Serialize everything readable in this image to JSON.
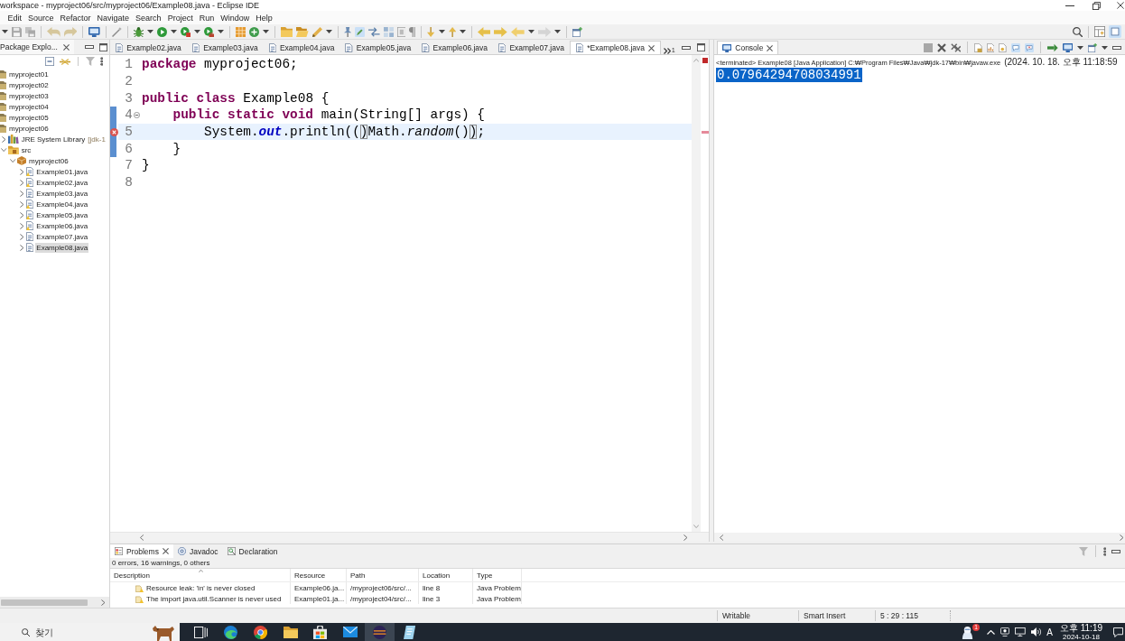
{
  "window": {
    "title": "workspace - myproject06/src/myproject06/Example08.java - Eclipse IDE"
  },
  "menu": [
    "Edit",
    "Source",
    "Refactor",
    "Navigate",
    "Search",
    "Project",
    "Run",
    "Window",
    "Help"
  ],
  "package_explorer": {
    "title": "Package Explo...",
    "tree": [
      {
        "label": "myproject01",
        "kind": "project",
        "selected": false
      },
      {
        "label": "myproject02",
        "kind": "project",
        "selected": false
      },
      {
        "label": "myproject03",
        "kind": "project",
        "selected": false
      },
      {
        "label": "myproject04",
        "kind": "project",
        "selected": false
      },
      {
        "label": "myproject05",
        "kind": "project",
        "selected": false
      },
      {
        "label": "myproject06",
        "kind": "project",
        "selected": false,
        "children": [
          {
            "label": "JRE System Library",
            "decoration": "[jdk-1",
            "kind": "library",
            "expanded": false,
            "selected": false
          },
          {
            "label": "src",
            "kind": "source-folder",
            "expanded": true,
            "selected": false,
            "children": [
              {
                "label": "myproject06",
                "kind": "package",
                "expanded": true,
                "selected": false,
                "children": [
                  {
                    "label": "Example01.java",
                    "kind": "java-file",
                    "warning": true,
                    "expanded": false,
                    "selected": false
                  },
                  {
                    "label": "Example02.java",
                    "kind": "java-file",
                    "warning": true,
                    "expanded": false,
                    "selected": false
                  },
                  {
                    "label": "Example03.java",
                    "kind": "java-file",
                    "warning": false,
                    "expanded": false,
                    "selected": false
                  },
                  {
                    "label": "Example04.java",
                    "kind": "java-file",
                    "warning": true,
                    "expanded": false,
                    "selected": false
                  },
                  {
                    "label": "Example05.java",
                    "kind": "java-file",
                    "warning": true,
                    "expanded": false,
                    "selected": false
                  },
                  {
                    "label": "Example06.java",
                    "kind": "java-file",
                    "warning": true,
                    "expanded": false,
                    "selected": false
                  },
                  {
                    "label": "Example07.java",
                    "kind": "java-file",
                    "warning": false,
                    "expanded": false,
                    "selected": false
                  },
                  {
                    "label": "Example08.java",
                    "kind": "java-file",
                    "warning": false,
                    "expanded": false,
                    "selected": true
                  }
                ]
              }
            ]
          }
        ]
      }
    ]
  },
  "editor": {
    "tabs": [
      {
        "label": "Example02.java",
        "selected": false
      },
      {
        "label": "Example03.java",
        "selected": false
      },
      {
        "label": "Example04.java",
        "selected": false
      },
      {
        "label": "Example05.java",
        "selected": false
      },
      {
        "label": "Example06.java",
        "selected": false
      },
      {
        "label": "Example07.java",
        "selected": false
      },
      {
        "label": "*Example08.java",
        "selected": true
      }
    ],
    "hidden_tab_count": "1",
    "lines": [
      {
        "number": "1",
        "range": false,
        "foldable": false,
        "error": false,
        "current": false,
        "tokens": [
          {
            "kind": "keyword",
            "text": "package"
          },
          {
            "kind": "plain",
            "text": " myproject06;"
          }
        ]
      },
      {
        "number": "2",
        "range": false,
        "foldable": false,
        "error": false,
        "current": false
      },
      {
        "number": "3",
        "range": false,
        "foldable": false,
        "error": false,
        "current": false,
        "tokens": [
          {
            "kind": "keyword",
            "text": "public"
          },
          {
            "kind": "keyword",
            "text": " class"
          },
          {
            "kind": "plain",
            "text": " Example08 {"
          }
        ]
      },
      {
        "number": "4",
        "range": true,
        "foldable": true,
        "error": false,
        "current": false,
        "tokens": [
          {
            "kind": "keyword",
            "text": "    public"
          },
          {
            "kind": "keyword",
            "text": " static"
          },
          {
            "kind": "keyword",
            "text": " void"
          },
          {
            "kind": "plain",
            "text": " main(String[] args) {"
          }
        ]
      },
      {
        "number": "5",
        "range": true,
        "foldable": false,
        "error": true,
        "current": true,
        "tokens": [
          {
            "kind": "plain",
            "text": "        System."
          },
          {
            "kind": "field",
            "text": "out"
          },
          {
            "kind": "plain",
            "text": ".println(("
          },
          {
            "kind": "matched-bracket",
            "text": ")"
          },
          {
            "kind": "plain",
            "text": "Math."
          },
          {
            "kind": "static-method",
            "text": "random"
          },
          {
            "kind": "plain",
            "text": "()"
          },
          {
            "kind": "matched-bracket",
            "text": ")"
          },
          {
            "kind": "plain",
            "text": ";"
          }
        ]
      },
      {
        "number": "6",
        "range": true,
        "foldable": false,
        "error": false,
        "current": false,
        "tokens": [
          {
            "kind": "plain",
            "text": "    }"
          }
        ]
      },
      {
        "number": "7",
        "range": false,
        "foldable": false,
        "error": false,
        "current": false,
        "tokens": [
          {
            "kind": "plain",
            "text": "}"
          }
        ]
      },
      {
        "number": "8",
        "range": false,
        "foldable": false,
        "error": false,
        "current": false
      }
    ]
  },
  "console": {
    "title": "Console",
    "launch": "<terminated> Example08 [Java Application] C:₩Program Files₩Java₩jdk-17₩bin₩javaw.exe",
    "timestamp": "(2024. 10. 18. 오후 11:18:59",
    "output": [
      {
        "text": "0.07964294708034991",
        "selected": true
      }
    ]
  },
  "problems": {
    "tabs": [
      {
        "label": "Problems",
        "kind": "problems",
        "selected": true
      },
      {
        "label": "Javadoc",
        "kind": "javadoc",
        "selected": false
      },
      {
        "label": "Declaration",
        "kind": "declaration",
        "selected": false
      }
    ],
    "summary": "0 errors, 16 warnings, 0 others",
    "columns": [
      {
        "label": "Description",
        "sorted": true
      },
      {
        "label": "Resource",
        "sorted": false
      },
      {
        "label": "Path",
        "sorted": false
      },
      {
        "label": "Location",
        "sorted": false
      },
      {
        "label": "Type",
        "sorted": false
      }
    ],
    "rows": [
      {
        "kind": "warning",
        "cells": [
          "Resource leak: 'in' is never closed",
          "Example06.ja...",
          "/myproject06/src/...",
          "line 8",
          "Java Problem"
        ]
      },
      {
        "kind": "warning",
        "cells": [
          "The import java.util.Scanner is never used",
          "Example01.ja...",
          "/myproject04/src/...",
          "line 3",
          "Java Problem"
        ]
      }
    ]
  },
  "status_bar": [
    "Writable",
    "Smart Insert",
    "5 : 29 : 115"
  ],
  "taskbar": {
    "search": {
      "placeholder": "찾기"
    },
    "apps": [
      {
        "kind": "task-view",
        "selected": false
      },
      {
        "kind": "browser-swirl",
        "selected": false
      },
      {
        "kind": "browser-ring",
        "selected": false
      },
      {
        "kind": "folder",
        "selected": false
      },
      {
        "kind": "store",
        "selected": false
      },
      {
        "kind": "mail",
        "selected": false
      },
      {
        "kind": "ide",
        "selected": true
      },
      {
        "kind": "notes",
        "selected": false
      }
    ],
    "tray": {
      "badge": "1",
      "ime": "A",
      "time": "오후 11:19",
      "date": "2024-10-18"
    }
  }
}
